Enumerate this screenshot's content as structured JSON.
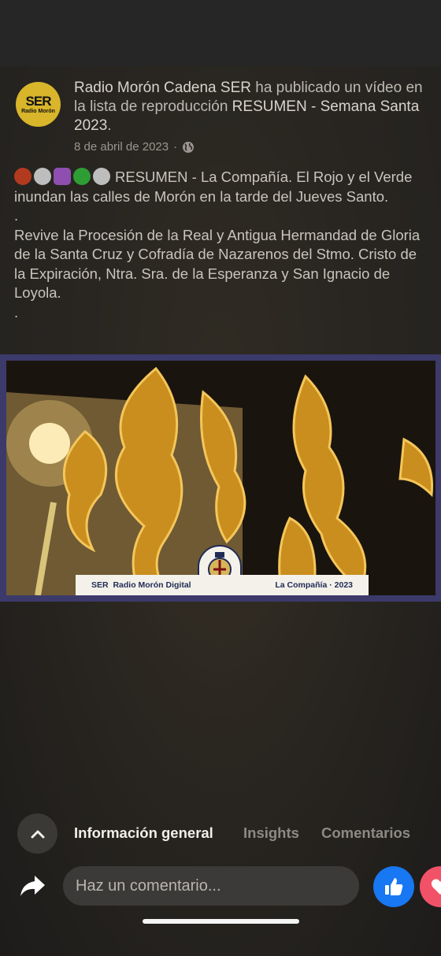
{
  "post": {
    "page_name": "Radio Morón Cadena SER",
    "action_text": " ha publicado un vídeo en la lista de reproducción ",
    "playlist": "RESUMEN - Semana Santa 2023",
    "playlist_suffix": ".",
    "date": "8 de abril de 2023",
    "separator": "·",
    "avatar": {
      "logo": "SER",
      "sub": "Radio Morón"
    },
    "emojis": [
      {
        "name": "red-circle-emoji",
        "color": "#b23a1f",
        "shape": "circle"
      },
      {
        "name": "white-circle-emoji",
        "color": "#bdbdbd",
        "shape": "circle"
      },
      {
        "name": "orthodox-cross-emoji",
        "color": "#8e4fb0",
        "shape": "square"
      },
      {
        "name": "green-circle-emoji",
        "color": "#2e9e34",
        "shape": "circle"
      },
      {
        "name": "white-circle-emoji",
        "color": "#bdbdbd",
        "shape": "circle"
      }
    ],
    "body_line1": "RESUMEN - La Compañía. El Rojo y el Verde inundan las calles de Morón en la tarde del Jueves Santo.",
    "dot1": ".",
    "body_line2": "Revive la Procesión de la Real y Antigua Hermandad de Gloria de la Santa Cruz y Cofradía de Nazarenos del Stmo. Cristo de la Expiración, Ntra. Sra. de la Esperanza y San Ignacio de Loyola.",
    "dot2": "."
  },
  "video": {
    "brand": "SER",
    "channel": "Radio Morón Digital",
    "title": "La Compañía · 2023"
  },
  "tabs": {
    "general": "Información general",
    "insights": "Insights",
    "comments": "Comentarios"
  },
  "comment": {
    "placeholder": "Haz un comentario..."
  },
  "colors": {
    "like": "#1877f2",
    "love": "#f25268",
    "avatar": "#d8b52a"
  }
}
